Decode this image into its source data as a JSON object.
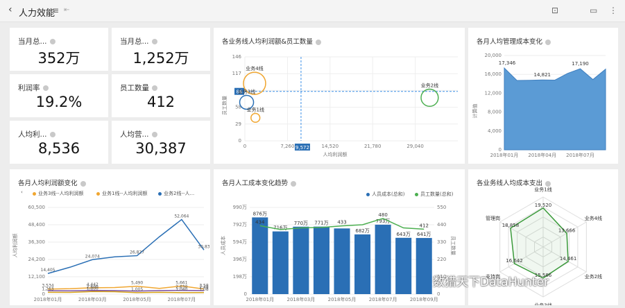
{
  "app": {
    "title": "人力效能"
  },
  "kpis": [
    {
      "label": "当月总...",
      "value": "352万"
    },
    {
      "label": "当月总...",
      "value": "1,252万"
    },
    {
      "label": "利润率",
      "value": "19.2%"
    },
    {
      "label": "员工数量",
      "value": "412"
    },
    {
      "label": "人均利...",
      "value": "8,536"
    },
    {
      "label": "人均营...",
      "value": "30,387"
    }
  ],
  "chart_data": [
    {
      "type": "scatter",
      "title": "各业务线人均利润额&员工数量",
      "xlabel": "人均利润额",
      "ylabel": "员工数量",
      "xticks": [
        "0",
        "7,260",
        "14,520",
        "21,780",
        "29,040"
      ],
      "yticks": [
        "0",
        "29",
        "58",
        "88",
        "117",
        "146"
      ],
      "xlim": [
        0,
        36300
      ],
      "ylim": [
        0,
        146
      ],
      "points": [
        {
          "name": "业务4线",
          "x": 1650,
          "y": 100,
          "size": 1.0,
          "color": "#f0a630"
        },
        {
          "name": "业务2线",
          "x": 31500,
          "y": 75,
          "size": 0.7,
          "color": "#4caf50"
        },
        {
          "name": "业务3线",
          "x": 300,
          "y": 67,
          "size": 0.5,
          "color": "#2a6fb5"
        },
        {
          "name": "业务1线",
          "x": 1800,
          "y": 40,
          "size": 0.2,
          "color": "#f0a630"
        }
      ],
      "ref_x": "9,572",
      "ref_y": "86",
      "ref_values": {
        "x": 9572,
        "y": 86
      }
    },
    {
      "type": "area",
      "title": "各月人均管理成本变化",
      "ylabel": "计算值",
      "categories": [
        "2018年01月",
        "2018年02月",
        "2018年03月",
        "2018年04月",
        "2018年05月",
        "2018年06月",
        "2018年07月",
        "2018年08月",
        "2018年09月"
      ],
      "xticks": [
        "2018年01月",
        "2018年04月",
        "2018年07月"
      ],
      "yticks": [
        "0",
        "4,000",
        "8,000",
        "12,000",
        "16,000",
        "20,000"
      ],
      "ylim": [
        0,
        20000
      ],
      "values": [
        17346,
        14700,
        14750,
        14821,
        14780,
        16200,
        17190,
        14900,
        17100
      ],
      "labels": [
        "17,346",
        "",
        "",
        "14,821",
        "",
        "",
        "17,190",
        "",
        ""
      ],
      "color": "#5b9bd5"
    },
    {
      "type": "line",
      "title": "各月人均利润额变化",
      "ylabel": "人均利润额",
      "legend": [
        "业务3线--人均利润额",
        "业务1线--人均利润额",
        "业务2线--人..."
      ],
      "categories": [
        "2018年01月",
        "2018年02月",
        "2018年03月",
        "2018年04月",
        "2018年05月",
        "2018年06月",
        "2018年07月",
        "2018年08月"
      ],
      "xticks": [
        "2018年01月",
        "2018年03月",
        "2018年05月",
        "2018年07月",
        "2018年0"
      ],
      "yticks": [
        "0",
        "12,100",
        "24,200",
        "36,300",
        "48,400",
        "60,500"
      ],
      "ylim": [
        0,
        60500
      ],
      "series": [
        {
          "name": "业务2线--人...",
          "color": "#2a6fb5",
          "values": [
            14405,
            18800,
            24074,
            26000,
            26827,
            40000,
            52064,
            30800
          ],
          "labels": [
            "14,405",
            "",
            "24,074",
            "",
            "26,827",
            "",
            "52,064",
            "30,83"
          ]
        },
        {
          "name": "业务1线--人均利润额",
          "color": "#f0a630",
          "values": [
            3534,
            3800,
            4442,
            4600,
            5490,
            4000,
            5661,
            3580
          ],
          "labels": [
            "3,534",
            "",
            "4,442",
            "",
            "5,490",
            "",
            "5,661",
            "3,58"
          ]
        },
        {
          "name": "业务3线--人均利润额",
          "color": "#7b4fa3",
          "values": [
            2400,
            2300,
            2600,
            2500,
            2100,
            2500,
            2630,
            2480
          ],
          "labels": [
            "",
            "",
            "2,600",
            "",
            "",
            "",
            "2,630",
            "2,48"
          ]
        },
        {
          "name": "",
          "color": "#d4a017",
          "values": [
            1263,
            1200,
            1800,
            1700,
            1005,
            1300,
            1040,
            1080
          ],
          "labels": [
            "1,263",
            "",
            "1,800",
            "",
            "1,005",
            "",
            "1,040",
            "1,08"
          ]
        }
      ]
    },
    {
      "type": "bar",
      "title": "各月人工成本变化趋势",
      "legend": [
        "人员成本(总和)",
        "员工数量(总和)"
      ],
      "ylabel": "人员成本",
      "y2label": "员工数量",
      "categories": [
        "2018年01月",
        "2018年02月",
        "2018年03月",
        "2018年04月",
        "2018年05月",
        "2018年06月",
        "2018年07月",
        "2018年08月",
        "2018年09月"
      ],
      "xticks": [
        "2018年01月",
        "2018年03月",
        "2018年05月",
        "2018年07月",
        "2018年09月"
      ],
      "yticks": [
        "0",
        "198万",
        "396万",
        "594万",
        "792万",
        "990万"
      ],
      "y2ticks": [
        "0",
        "110",
        "220",
        "330",
        "440",
        "550"
      ],
      "ylim": [
        0,
        990
      ],
      "y2lim": [
        0,
        550
      ],
      "bar_values": [
        876,
        716,
        770,
        771,
        750,
        682,
        793,
        643,
        641
      ],
      "bar_labels": [
        "876万",
        "716万",
        "770万",
        "771万",
        "",
        "682万",
        "793万",
        "643万",
        "641万"
      ],
      "line_values": [
        434,
        410,
        420,
        423,
        433,
        440,
        480,
        420,
        412
      ],
      "line_labels": [
        "434",
        "",
        "",
        "",
        "433",
        "",
        "480",
        "",
        "412"
      ],
      "bar_color": "#2a6fb5",
      "line_color": "#4caf50"
    },
    {
      "type": "radar",
      "title": "各业务线人均成本支出",
      "axes": [
        "业务1线",
        "业务4线",
        "业务2线",
        "业务3线",
        "支持岗",
        "管理岗"
      ],
      "values": [
        19520,
        13666,
        14461,
        15586,
        16642,
        18858
      ],
      "labels": [
        "19,520",
        "13,666",
        "14,461",
        "15,586",
        "16,642",
        "18,858"
      ],
      "max": 25000,
      "color": "#3a9a3a"
    }
  ],
  "watermark": "数猎天下DataHunter"
}
